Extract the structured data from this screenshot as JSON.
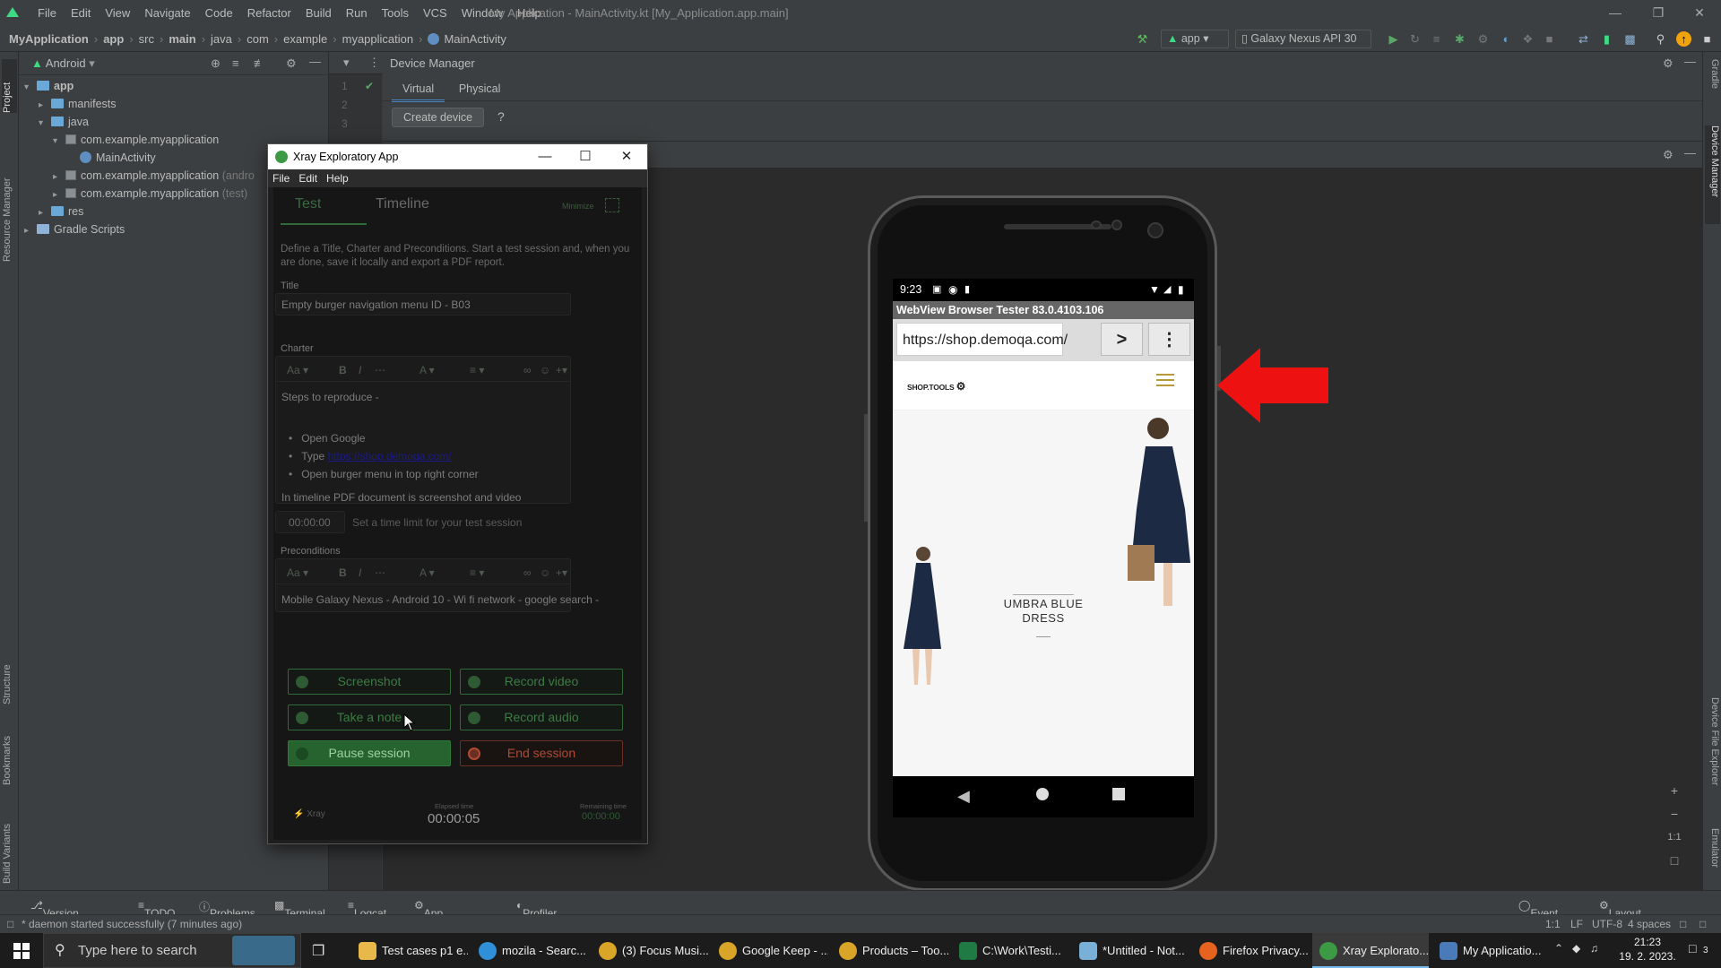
{
  "menubar": {
    "items": [
      "File",
      "Edit",
      "View",
      "Navigate",
      "Code",
      "Refactor",
      "Build",
      "Run",
      "Tools",
      "VCS",
      "Window",
      "Help"
    ],
    "window_title": "My Application - MainActivity.kt [My_Application.app.main]"
  },
  "navbar": {
    "crumbs": [
      "MyApplication",
      "app",
      "src",
      "main",
      "java",
      "com",
      "example",
      "myapplication",
      "MainActivity"
    ],
    "run_config": "app",
    "device": "Galaxy Nexus API 30"
  },
  "project": {
    "view": "Android",
    "tree": [
      {
        "label": "app",
        "suffix": ""
      },
      {
        "label": "manifests",
        "suffix": ""
      },
      {
        "label": "java",
        "suffix": ""
      },
      {
        "label": "com.example.myapplication",
        "suffix": ""
      },
      {
        "label": "MainActivity",
        "suffix": ""
      },
      {
        "label": "com.example.myapplication",
        "suffix": "(andro"
      },
      {
        "label": "com.example.myapplication",
        "suffix": "(test)"
      },
      {
        "label": "res",
        "suffix": ""
      },
      {
        "label": "Gradle Scripts",
        "suffix": ""
      }
    ]
  },
  "side_tabs": {
    "left": [
      "Project",
      "Resource Manager",
      "Structure",
      "Bookmarks",
      "Build Variants"
    ],
    "right": [
      "Gradle",
      "Device Manager",
      "Device File Explorer",
      "Emulator"
    ]
  },
  "editor": {
    "lines": [
      "1",
      "2",
      "3"
    ]
  },
  "device_manager": {
    "title": "Device Manager",
    "tabs": [
      "Virtual",
      "Physical"
    ],
    "create_button": "Create device",
    "help": "?"
  },
  "phone": {
    "time": "9:23",
    "webview_title": "WebView Browser Tester 83.0.4103.106",
    "url": "https://shop.demoqa.com/",
    "go": ">",
    "menu": "⋮",
    "shop_logo": "SHOP.TOOLS",
    "hero_title_line1": "UMBRA BLUE",
    "hero_title_line2": "DRESS"
  },
  "emulator_tools": {
    "plus": "+",
    "minus": "−",
    "ratio": "1:1"
  },
  "xray": {
    "window_title": "Xray Exploratory App",
    "menu": [
      "File",
      "Edit",
      "Help"
    ],
    "tabs": [
      "Test",
      "Timeline"
    ],
    "minimize": "Minimize",
    "intro": "Define a Title, Charter and Preconditions. Start a test session and, when you are done, save it locally and export a PDF report.",
    "title_label": "Title",
    "title_value": "Empty burger navigation menu ID - B03",
    "charter_label": "Charter",
    "charter_heading": "Steps to reproduce  -",
    "charter_steps": [
      "Open Google",
      "Type",
      "Open burger menu in top right corner"
    ],
    "charter_link": "https://shop.demoqa.com/",
    "charter_footer": "In timeline PDF document is screenshot and video",
    "time_limit_value": "00:00:00",
    "time_limit_hint": "Set a time limit for your test session",
    "preconditions_label": "Preconditions",
    "preconditions_value": "Mobile Galaxy Nexus - Android 10 - Wi fi network - google search -",
    "toolbar_font": "Aa",
    "buttons": {
      "screenshot": "Screenshot",
      "record_video": "Record video",
      "take_note": "Take a note",
      "record_audio": "Record audio",
      "pause": "Pause session",
      "end": "End session"
    },
    "footer_brand": "Xray",
    "elapsed_label": "Elapsed time",
    "elapsed_value": "00:00:05",
    "remaining_label": "Remaining time",
    "remaining_value": "00:00:00"
  },
  "bottom_tools": [
    "Version Control",
    "TODO",
    "Problems",
    "Terminal",
    "Logcat",
    "App Inspection",
    "Profiler"
  ],
  "bottom_right_tools": [
    "Event Log",
    "Layout Inspector"
  ],
  "status": {
    "message": "* daemon started successfully (7 minutes ago)",
    "position": "1:1",
    "line_sep": "LF",
    "encoding": "UTF-8",
    "indent": "4 spaces"
  },
  "taskbar": {
    "search_placeholder": "Type here to search",
    "apps": [
      "Test cases p1 e...",
      "mozila - Searc...",
      "(3) Focus Musi...",
      "Google Keep - ...",
      "Products – Too...",
      "C:\\Work\\Testi...",
      "*Untitled - Not...",
      "Firefox Privacy...",
      "Xray Explorato...",
      "My Applicatio..."
    ],
    "time": "21:23",
    "date": "19. 2. 2023.",
    "notif_count": "3"
  }
}
